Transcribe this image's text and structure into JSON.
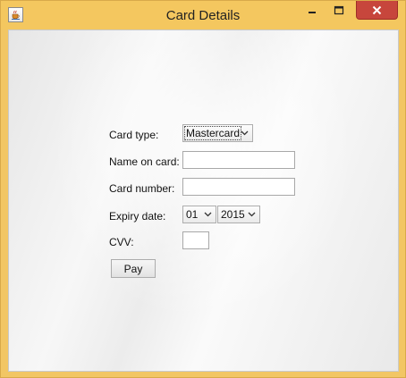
{
  "window": {
    "title": "Card Details"
  },
  "form": {
    "card_type_label": "Card type:",
    "card_type_value": "Mastercard",
    "name_label": "Name on card:",
    "name_value": "",
    "number_label": "Card number:",
    "number_value": "",
    "expiry_label": "Expiry date:",
    "expiry_month": "01",
    "expiry_year": "2015",
    "cvv_label": "CVV:",
    "cvv_value": "",
    "pay_label": "Pay"
  },
  "colors": {
    "titlebar": "#f4c75f",
    "close_button": "#c7463c"
  },
  "icons": {
    "app": "java-cup-icon",
    "minimize": "minimize-icon",
    "maximize": "maximize-icon",
    "close": "close-icon",
    "dropdown": "chevron-down-icon"
  }
}
